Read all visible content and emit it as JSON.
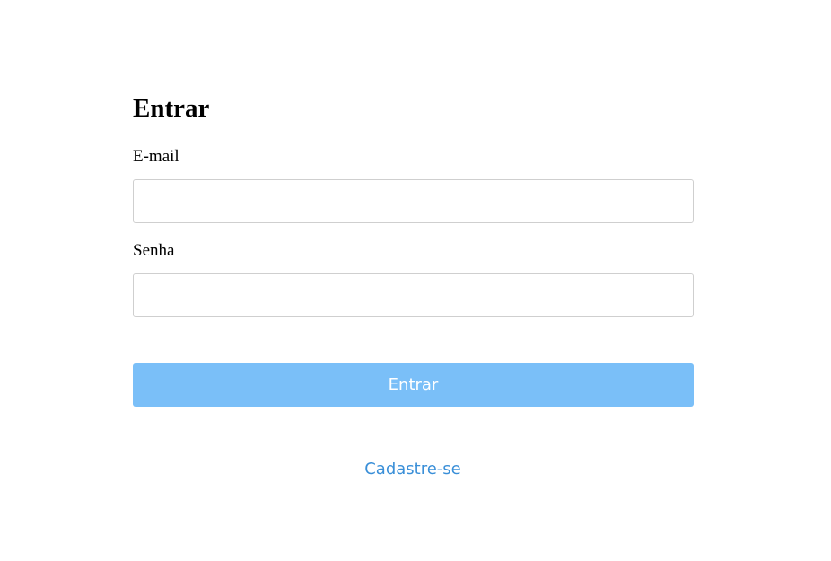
{
  "form": {
    "title": "Entrar",
    "email": {
      "label": "E-mail",
      "value": "",
      "placeholder": ""
    },
    "password": {
      "label": "Senha",
      "value": "",
      "placeholder": ""
    },
    "submit_label": "Entrar"
  },
  "signup_link": "Cadastre-se",
  "colors": {
    "button_background": "#7abff8",
    "button_text": "#ffffff",
    "link": "#3a8fd8",
    "input_border": "#cfcfcf"
  }
}
